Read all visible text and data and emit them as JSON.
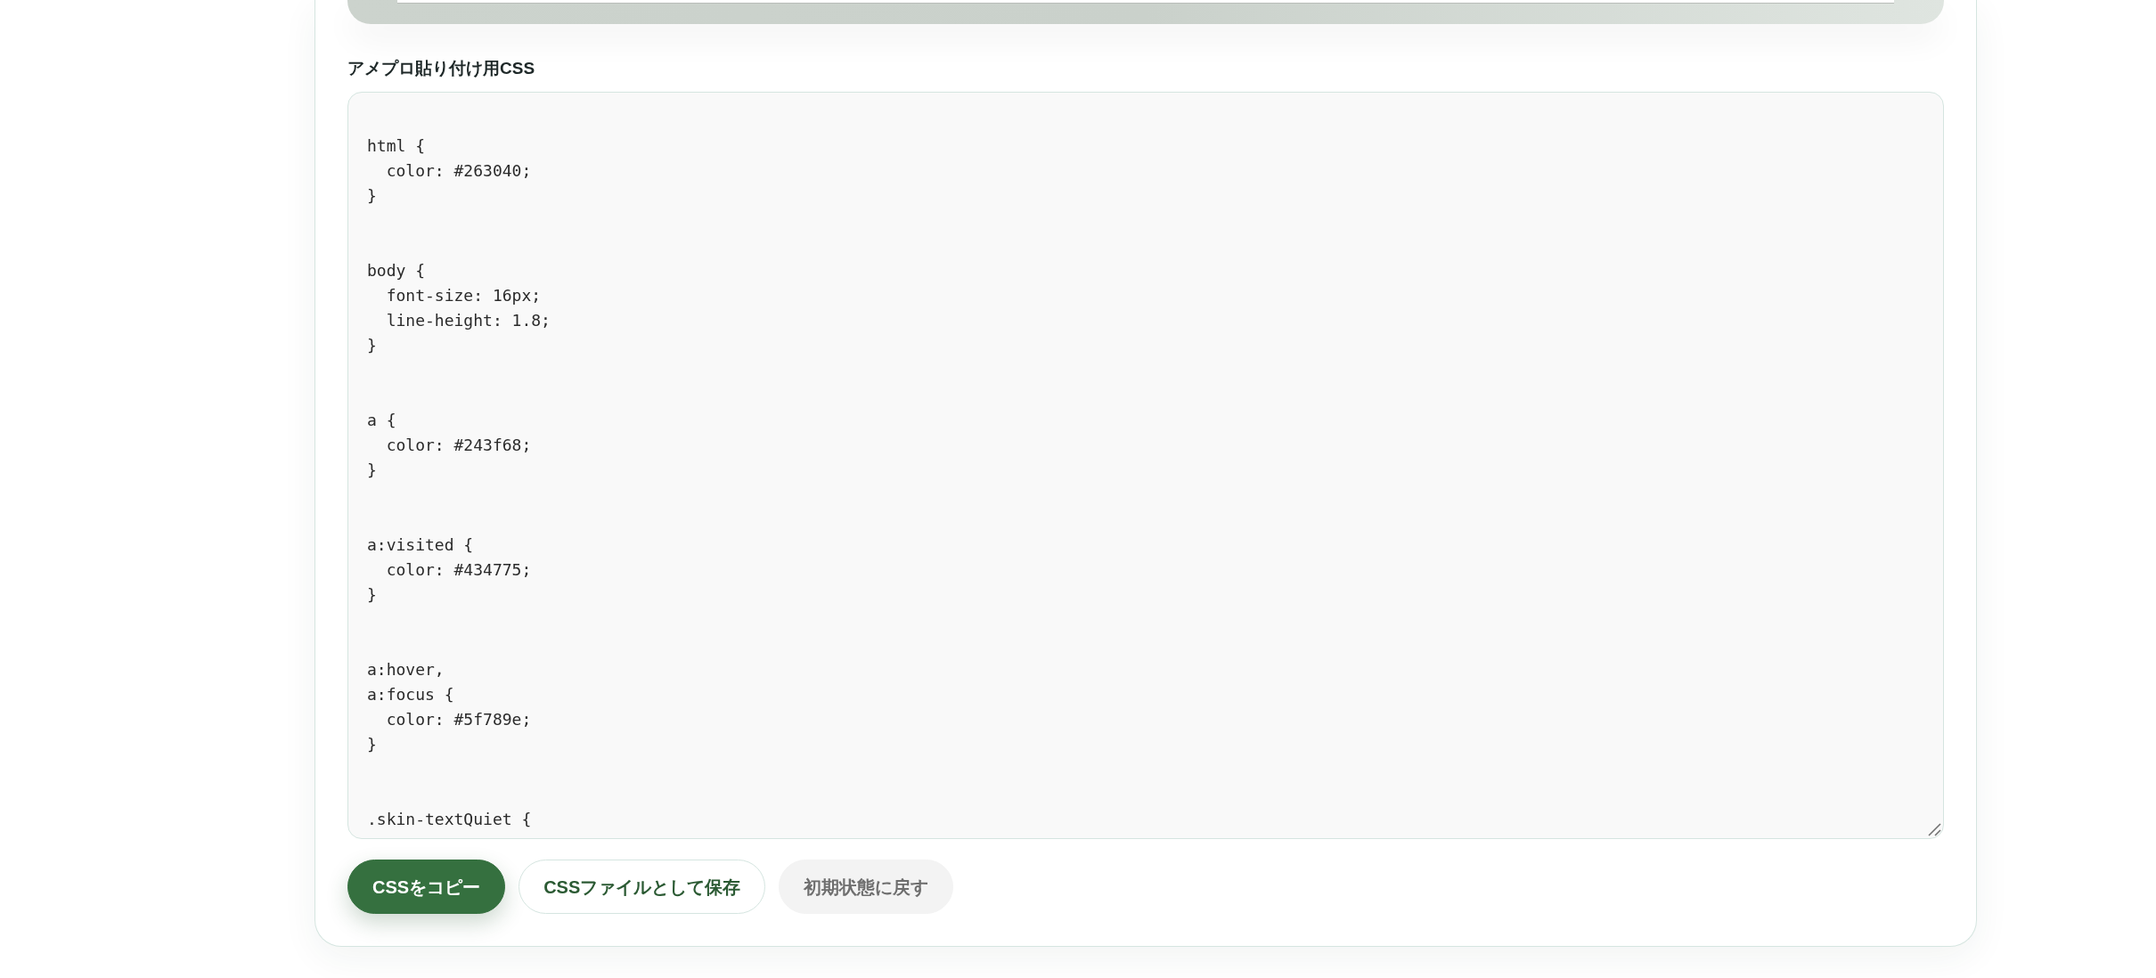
{
  "css_section": {
    "label": "アメプロ貼り付け用CSS",
    "code": "html {\n  color: #263040;\n}\n\n\nbody {\n  font-size: 16px;\n  line-height: 1.8;\n}\n\n\na {\n  color: #243f68;\n}\n\n\na:visited {\n  color: #434775;\n}\n\n\na:hover,\na:focus {\n  color: #5f789e;\n}\n\n\n.skin-textQuiet {"
  },
  "buttons": [
    {
      "label": "CSSをコピー",
      "kind": "primary"
    },
    {
      "label": "CSSファイルとして保存",
      "kind": "secondary"
    },
    {
      "label": "初期状態に戻す",
      "kind": "tertiary"
    }
  ]
}
